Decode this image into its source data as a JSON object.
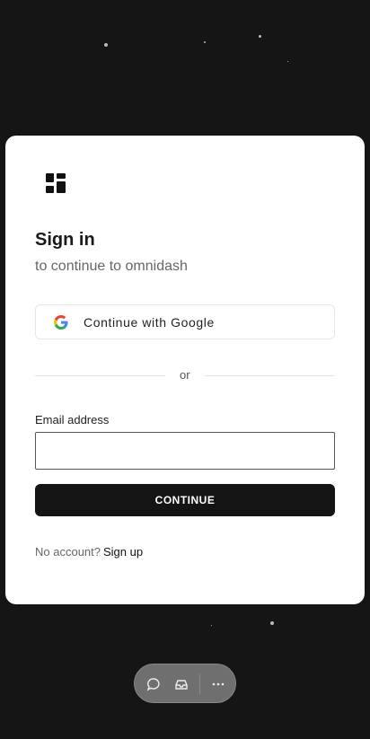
{
  "app": "omnidash",
  "signin": {
    "title": "Sign in",
    "subtitle": "to continue to omnidash",
    "google_label": "Continue with Google",
    "divider": "or",
    "email_label": "Email address",
    "email_value": "",
    "continue_label": "CONTINUE",
    "no_account": "No account?",
    "signup_label": "Sign up"
  },
  "toolbar": {
    "icons": [
      "chat-icon",
      "inbox-icon",
      "more-icon"
    ]
  }
}
